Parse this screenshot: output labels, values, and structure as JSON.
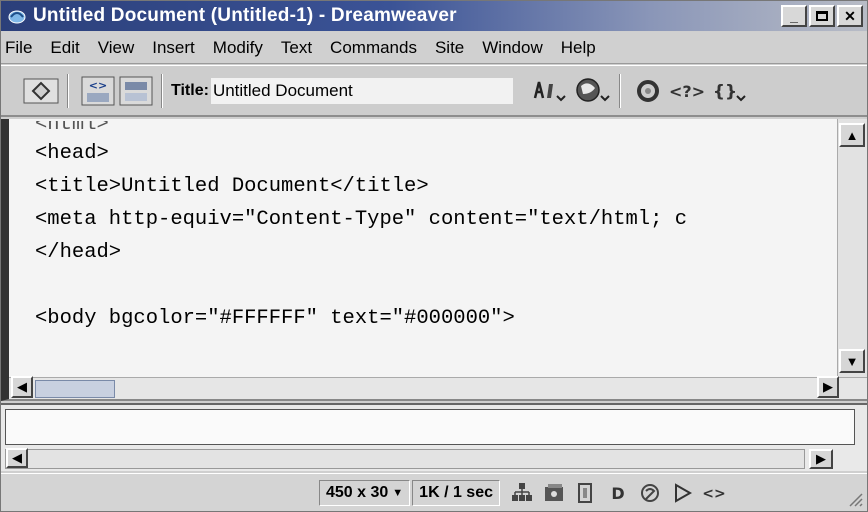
{
  "window": {
    "title": "Untitled Document (Untitled-1) - Dreamweaver"
  },
  "menu": {
    "items": [
      "File",
      "Edit",
      "View",
      "Insert",
      "Modify",
      "Text",
      "Commands",
      "Site",
      "Window",
      "Help"
    ]
  },
  "toolbar": {
    "title_label": "Title:",
    "title_value": "Untitled Document",
    "buttons": [
      "show-code-view-icon",
      "show-code-and-design-icon",
      "show-design-view-icon",
      "file-management-icon",
      "preview-in-browser-icon",
      "refresh-icon",
      "reference-icon",
      "code-navigation-icon"
    ]
  },
  "code": {
    "lines": [
      "<html>",
      "<head>",
      "<title>Untitled Document</title>",
      "<meta http-equiv=\"Content-Type\" content=\"text/html; c",
      "</head>",
      "",
      "<body bgcolor=\"#FFFFFF\" text=\"#000000\">"
    ]
  },
  "status": {
    "window_size": "450 x 30",
    "download": "1K / 1 sec",
    "launcher_icons": [
      "site-icon",
      "assets-icon",
      "html-styles-icon",
      "css-styles-icon",
      "behaviors-icon",
      "history-icon",
      "code-inspector-icon"
    ]
  },
  "colors": {
    "titlebar_start": "#2b3f7a",
    "titlebar_end": "#b8bcc6",
    "chrome": "#cfcfcf",
    "editor_bg": "#f4f4f4"
  }
}
